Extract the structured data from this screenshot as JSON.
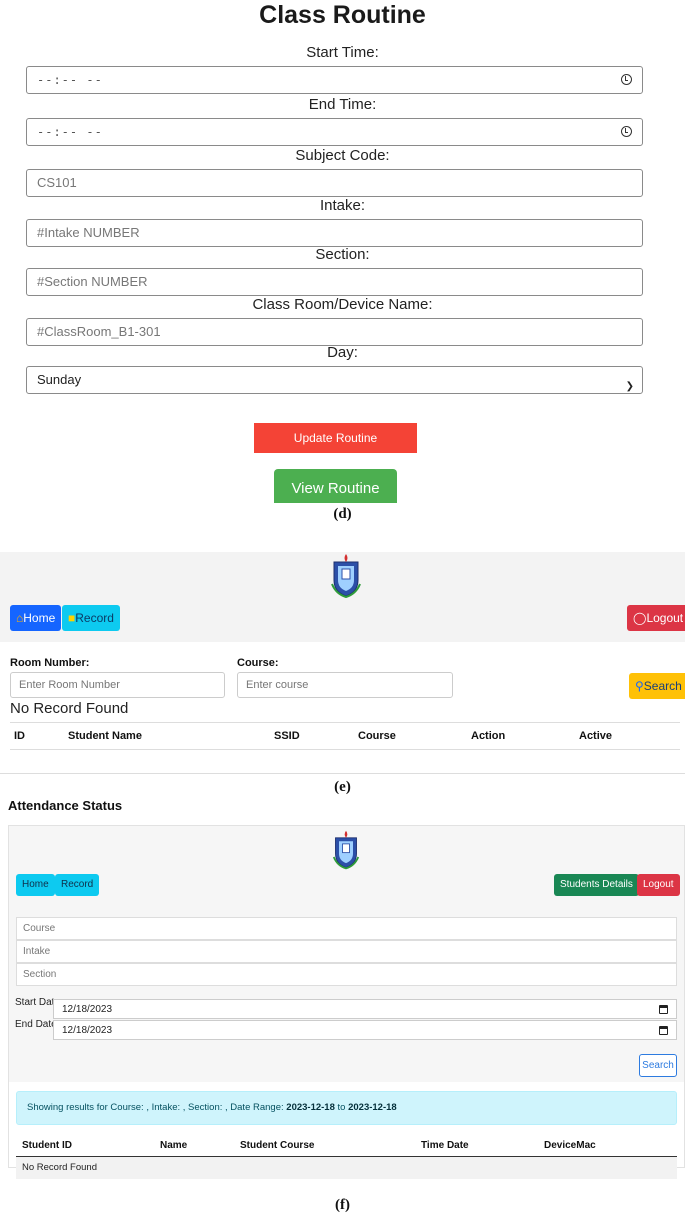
{
  "panel_d": {
    "title": "Class Routine",
    "start_time_label": "Start Time:",
    "start_time_value": "--:-- --",
    "end_time_label": "End Time:",
    "end_time_value": "--:-- --",
    "subject_code_label": "Subject Code:",
    "subject_code_placeholder": "CS101",
    "intake_label": "Intake:",
    "intake_placeholder": "#Intake NUMBER",
    "section_label": "Section:",
    "section_placeholder": "#Section NUMBER",
    "classroom_label": "Class Room/Device Name:",
    "classroom_placeholder": "#ClassRoom_B1-301",
    "day_label": "Day:",
    "day_selected": "Sunday",
    "update_button": "Update Routine",
    "view_button": "View Routine",
    "caption": "(d)"
  },
  "panel_e": {
    "home_button": "Home",
    "record_button": "Record",
    "logout_button": "Logout",
    "room_label": "Room Number:",
    "room_placeholder": "Enter Room Number",
    "course_label": "Course:",
    "course_placeholder": "Enter course",
    "search_button": "Search",
    "no_record": "No Record Found",
    "columns": [
      "ID",
      "Student Name",
      "SSID",
      "Course",
      "Action",
      "Active"
    ],
    "caption": "(e)"
  },
  "panel_f": {
    "heading": "Attendance Status",
    "home_button": "Home",
    "record_button": "Record",
    "students_details_button": "Students Details",
    "logout_button": "Logout",
    "course_placeholder": "Course",
    "intake_placeholder": "Intake",
    "section_placeholder": "Section",
    "start_date_label": "Start Date:",
    "start_date_value": "12/18/2023",
    "end_date_label": "End Date:",
    "end_date_value": "12/18/2023",
    "search_button": "Search",
    "alert_prefix": "Showing results for Course: , Intake: , Section: , Date Range: ",
    "alert_from": "2023-12-18",
    "alert_to_word": " to ",
    "alert_to": "2023-12-18",
    "columns": [
      "Student ID",
      "Name",
      "Student Course",
      "Time Date",
      "DeviceMac"
    ],
    "no_record": "No Record Found",
    "caption": "(f)"
  },
  "colors": {
    "update_red": "#f44336",
    "view_green": "#4caf50",
    "home_blue": "#1565ff",
    "record_yellow": "#ffd400",
    "logout_red": "#dc3545",
    "search_amber": "#ffc107",
    "cyan": "#0dcaf0",
    "success_green": "#198754",
    "alert_bg": "#cff4fc"
  }
}
